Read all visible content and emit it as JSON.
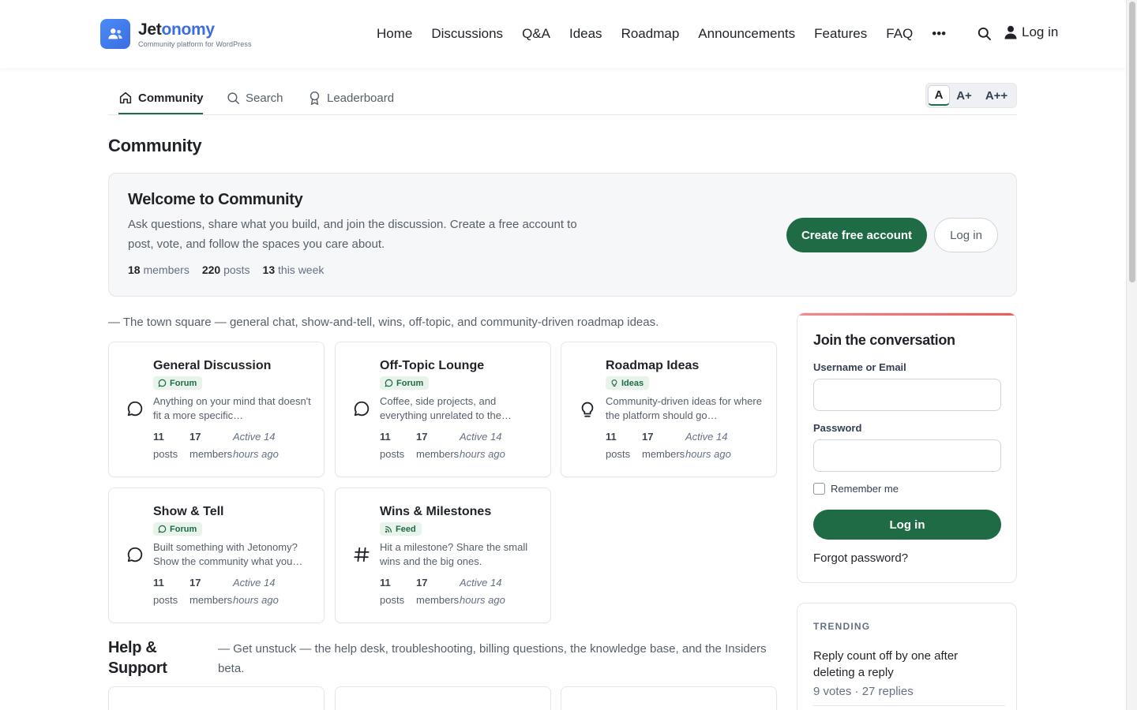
{
  "brand": {
    "name_part1": "Jet",
    "name_part2": "onomy",
    "tagline": "Community platform for WordPress",
    "accent": "#3b6de0"
  },
  "nav": {
    "items": [
      "Home",
      "Discussions",
      "Q&A",
      "Ideas",
      "Roadmap",
      "Announcements",
      "Features",
      "FAQ"
    ],
    "more": "•••",
    "login": "Log in"
  },
  "tabs": [
    {
      "label": "Community",
      "icon": "home-icon",
      "active": true
    },
    {
      "label": "Search",
      "icon": "search-icon",
      "active": false
    },
    {
      "label": "Leaderboard",
      "icon": "award-icon",
      "active": false
    }
  ],
  "font_sizes": [
    "A",
    "A+",
    "A++"
  ],
  "page_title": "Community",
  "welcome": {
    "title": "Welcome to Community",
    "description": "Ask questions, share what you build, and join the discussion. Create a free account to post, vote, and follow the spaces you care about.",
    "stats": [
      {
        "value": "18",
        "label": "members"
      },
      {
        "value": "220",
        "label": "posts"
      },
      {
        "value": "13",
        "label": "this week"
      }
    ],
    "create_account": "Create free account",
    "login": "Log in"
  },
  "town_square": {
    "description": "— The town square — general chat, show-and-tell, wins, off-topic, and community-driven roadmap ideas.",
    "spaces": [
      {
        "name": "General Discussion",
        "type": "Forum",
        "icon": "chat-bubble-icon",
        "description": "Anything on your mind that doesn't fit a more specific…",
        "posts_count": "11",
        "posts_label": "posts",
        "members_count": "17",
        "members_label": "members",
        "active_line1": "Active 14",
        "active_line2": "hours ago"
      },
      {
        "name": "Off-Topic Lounge",
        "type": "Forum",
        "icon": "chat-bubble-icon",
        "description": "Coffee, side projects, and everything unrelated to the…",
        "posts_count": "11",
        "posts_label": "posts",
        "members_count": "17",
        "members_label": "members",
        "active_line1": "Active 14",
        "active_line2": "hours ago"
      },
      {
        "name": "Roadmap Ideas",
        "type": "Ideas",
        "icon": "lightbulb-icon",
        "description": "Community-driven ideas for where the platform should go…",
        "posts_count": "11",
        "posts_label": "posts",
        "members_count": "17",
        "members_label": "members",
        "active_line1": "Active 14",
        "active_line2": "hours ago"
      },
      {
        "name": "Show & Tell",
        "type": "Forum",
        "icon": "chat-bubble-icon",
        "description": "Built something with Jetonomy? Show the community what you…",
        "posts_count": "11",
        "posts_label": "posts",
        "members_count": "17",
        "members_label": "members",
        "active_line1": "Active 14",
        "active_line2": "hours ago"
      },
      {
        "name": "Wins & Milestones",
        "type": "Feed",
        "icon": "hash-icon",
        "description": "Hit a milestone? Share the small wins and the big ones.",
        "posts_count": "11",
        "posts_label": "posts",
        "members_count": "17",
        "members_label": "members",
        "active_line1": "Active 14",
        "active_line2": "hours ago"
      }
    ]
  },
  "help_support": {
    "title": "Help & Support",
    "description": "— Get unstuck — the help desk, troubleshooting, billing questions, the knowledge base, and the Insiders beta."
  },
  "login_form": {
    "title": "Join the conversation",
    "username_label": "Username or Email",
    "username_value": "",
    "password_label": "Password",
    "password_value": "",
    "remember": "Remember me",
    "submit": "Log in",
    "forgot": "Forgot password?"
  },
  "trending": {
    "title": "TRENDING",
    "items": [
      {
        "title": "Reply count off by one after deleting a reply",
        "meta": "9 votes · 27 replies"
      }
    ]
  },
  "colors": {
    "primary_green": "#1f6b45",
    "badge_bg": "#e8f3ec",
    "accent_red": "#e85d5d"
  }
}
